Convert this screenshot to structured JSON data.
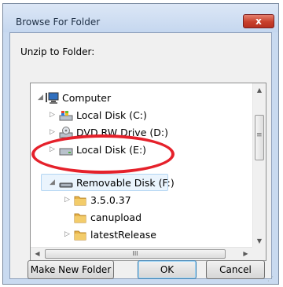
{
  "window": {
    "title": "Browse For Folder",
    "close_label": "x"
  },
  "dialog": {
    "instruction": "Unzip to Folder:"
  },
  "tree": {
    "items": [
      {
        "label": "Computer",
        "expander": "◢",
        "icon": "computer-icon"
      },
      {
        "label": "Local Disk (C:)",
        "expander": "▷",
        "icon": "windows-drive-icon"
      },
      {
        "label": "DVD RW Drive (D:)",
        "expander": "▷",
        "icon": "dvd-drive-icon"
      },
      {
        "label": "Local Disk (E:)",
        "expander": "▷",
        "icon": "drive-icon"
      },
      {
        "label": "Removable Disk (F:)",
        "expander": "◢",
        "icon": "removable-drive-icon",
        "selected": true
      },
      {
        "label": "3.5.0.37",
        "expander": "▷",
        "icon": "folder-icon"
      },
      {
        "label": "canupload",
        "expander": "",
        "icon": "folder-icon"
      },
      {
        "label": "latestRelease",
        "expander": "▷",
        "icon": "folder-icon"
      },
      {
        "label": "",
        "expander": "",
        "icon": "folder-icon"
      }
    ],
    "scroll_up": "▲",
    "scroll_down": "▼",
    "scroll_left": "◀",
    "scroll_right": "▶",
    "hthumb_grip": "III",
    "vthumb_grip": "≡"
  },
  "buttons": {
    "make_new_folder": "Make New Folder",
    "ok": "OK",
    "cancel": "Cancel"
  },
  "annotation": {
    "color": "#e5212b"
  },
  "colors": {
    "selection_fill": "#eaf4fd",
    "selection_border": "#b2d5f3",
    "window_frame": "#c9daf0"
  }
}
